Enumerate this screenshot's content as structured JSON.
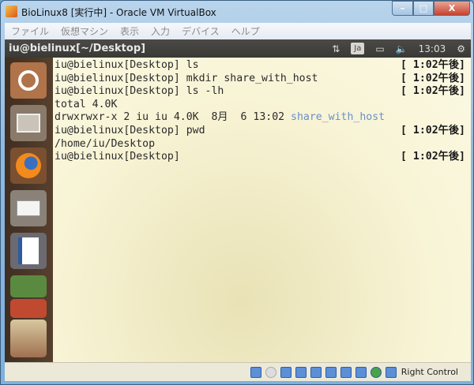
{
  "window": {
    "title": "BioLinux8 [実行中] - Oracle VM VirtualBox",
    "minimize": "–",
    "maximize": "□",
    "close": "X"
  },
  "menu": [
    "ファイル",
    "仮想マシン",
    "表示",
    "入力",
    "デバイス",
    "ヘルプ"
  ],
  "panel": {
    "title": "iu@bielinux[~/Desktop]",
    "keyboard": "Ja",
    "clock": "13:03"
  },
  "launcher": [
    "ubuntu-dash",
    "files",
    "firefox",
    "mail",
    "writer",
    "calc",
    "impress",
    "more"
  ],
  "terminal": {
    "lines": [
      {
        "text": "iu@bielinux[Desktop] ls",
        "time": "[ 1:02午後]"
      },
      {
        "text": "iu@bielinux[Desktop] mkdir share_with_host",
        "time": "[ 1:02午後]"
      },
      {
        "text": "iu@bielinux[Desktop] ls -lh",
        "time": "[ 1:02午後]"
      },
      {
        "text": "total 4.0K",
        "time": ""
      },
      {
        "text": "drwxrwxr-x 2 iu iu 4.0K  8月  6 13:02 ",
        "dir": "share_with_host",
        "time": ""
      },
      {
        "text": "iu@bielinux[Desktop] pwd",
        "time": "[ 1:02午後]"
      },
      {
        "text": "/home/iu/Desktop",
        "time": ""
      },
      {
        "text": "iu@bielinux[Desktop]",
        "time": "[ 1:02午後]"
      }
    ]
  },
  "status": {
    "host_key": "Right Control"
  }
}
